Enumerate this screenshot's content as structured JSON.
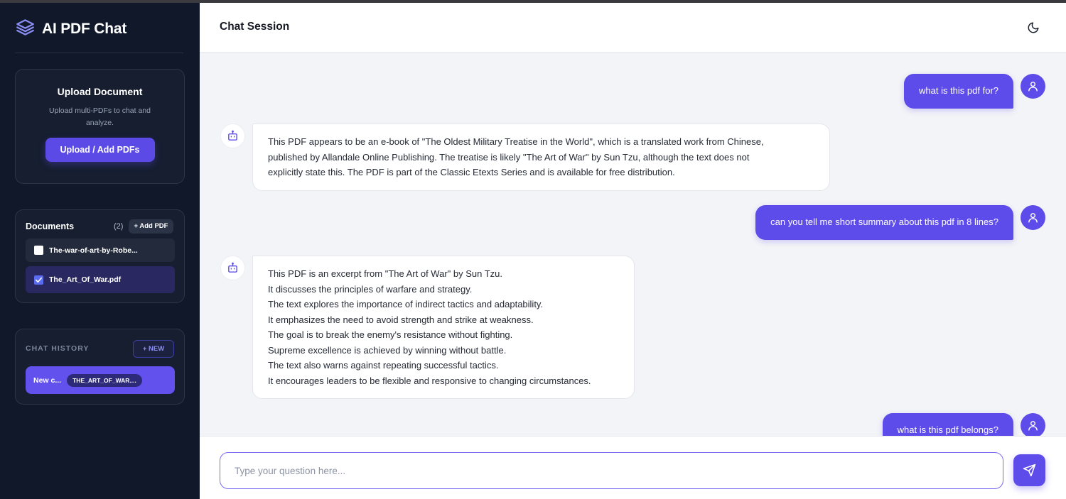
{
  "app": {
    "title": "AI PDF Chat",
    "logo_icon": "layers-icon"
  },
  "upload": {
    "title": "Upload Document",
    "description": "Upload multi-PDFs to chat and analyze.",
    "button_label": "Upload / Add PDFs"
  },
  "documents": {
    "heading": "Documents",
    "count": "(2)",
    "add_label": "+ Add PDF",
    "items": [
      {
        "name": "The-war-of-art-by-Robe...",
        "checked": false
      },
      {
        "name": "The_Art_Of_War.pdf",
        "checked": true
      }
    ]
  },
  "history": {
    "heading": "CHAT HISTORY",
    "new_label": "+ NEW",
    "items": [
      {
        "label": "New c...",
        "tag": "THE_ART_OF_WAR...."
      }
    ]
  },
  "header": {
    "title": "Chat Session",
    "theme_icon": "moon-icon"
  },
  "messages": [
    {
      "role": "user",
      "text": "what is this pdf for?"
    },
    {
      "role": "bot",
      "lines": [
        "This PDF appears to be an e-book of \"The Oldest Military Treatise in the World\", which is a translated work from Chinese,",
        "published by Allandale Online Publishing. The treatise is likely \"The Art of War\" by Sun Tzu, although the text does not",
        "explicitly state this. The PDF is part of the Classic Etexts Series and is available for free distribution."
      ]
    },
    {
      "role": "user",
      "text": "can you tell me short summary about this pdf in 8 lines?"
    },
    {
      "role": "bot",
      "lines": [
        "This PDF is an excerpt from \"The Art of War\" by Sun Tzu.",
        "It discusses the principles of warfare and strategy.",
        "The text explores the importance of indirect tactics and adaptability.",
        "It emphasizes the need to avoid strength and strike at weakness.",
        "The goal is to break the enemy's resistance without fighting.",
        "Supreme excellence is achieved by winning without battle.",
        "The text also warns against repeating successful tactics.",
        "It encourages leaders to be flexible and responsive to changing circumstances."
      ]
    },
    {
      "role": "user",
      "text": "what is this pdf belongs?"
    }
  ],
  "composer": {
    "placeholder": "Type your question here...",
    "send_icon": "send-icon"
  },
  "colors": {
    "accent": "#5d4bea",
    "sidebar": "#111829",
    "background": "#f3f4f7"
  }
}
